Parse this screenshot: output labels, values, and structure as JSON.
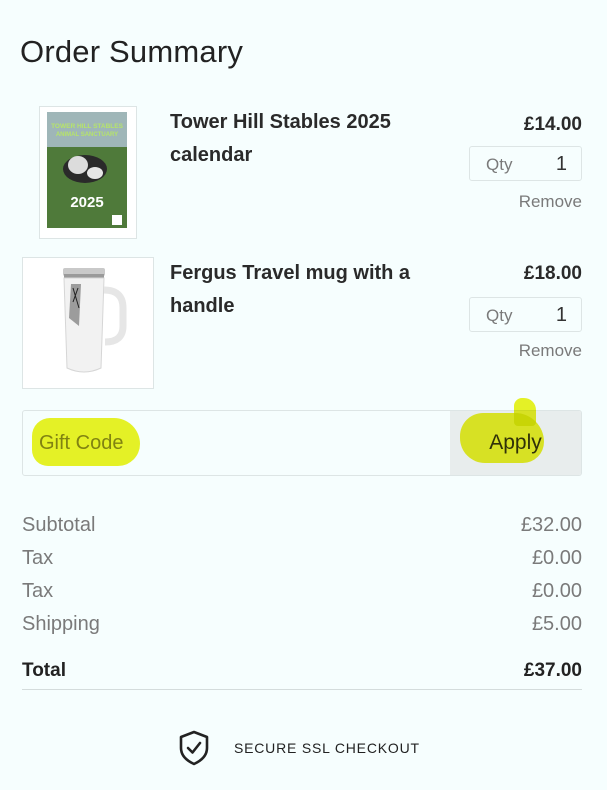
{
  "summary": {
    "title": "Order Summary"
  },
  "items": [
    {
      "name": "Tower Hill Stables 2025 calendar",
      "price": "£14.00",
      "qty_label": "Qty",
      "qty": "1",
      "remove_label": "Remove",
      "thumb": {
        "header_text": "TOWER HILL STABLES ANIMAL SANCTUARY",
        "year": "2025"
      }
    },
    {
      "name": "Fergus Travel mug with a handle",
      "price": "£18.00",
      "qty_label": "Qty",
      "qty": "1",
      "remove_label": "Remove"
    }
  ],
  "gift": {
    "placeholder": "Gift Code",
    "apply_label": "Apply",
    "highlight_color": "#eaf000"
  },
  "totals": {
    "rows": [
      {
        "label": "Subtotal",
        "value": "£32.00"
      },
      {
        "label": "Tax",
        "value": "£0.00"
      },
      {
        "label": "Tax",
        "value": "£0.00"
      },
      {
        "label": "Shipping",
        "value": "£5.00"
      }
    ],
    "total_label": "Total",
    "total_value": "£37.00"
  },
  "footer": {
    "secure_text": "SECURE SSL CHECKOUT",
    "secure_icon": "shield-check-icon"
  },
  "colors": {
    "background": "#f6fefe",
    "muted_text": "#7a7a7a",
    "border": "#dde5e5",
    "apply_bg": "#e8eded"
  }
}
